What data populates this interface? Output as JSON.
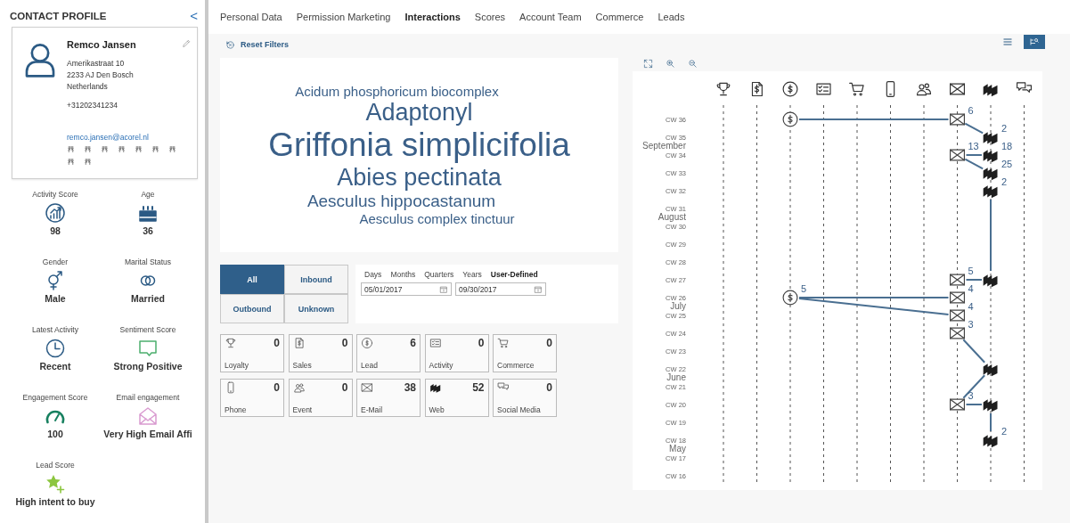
{
  "sidebar": {
    "title": "CONTACT PROFILE",
    "collapse": "<",
    "contact": {
      "name": "Remco Jansen",
      "address": [
        "Amerikastraat 10",
        "2233 AJ Den Bosch",
        "Netherlands"
      ],
      "phone": "+31202341234",
      "email": "remco.jansen@acorel.nl",
      "links": [
        {
          "kind": "link"
        },
        {
          "kind": "link"
        },
        {
          "kind": "link"
        },
        {
          "kind": "link"
        },
        {
          "kind": "link"
        },
        {
          "kind": "link"
        },
        {
          "kind": "link"
        },
        {
          "kind": "link"
        },
        {
          "kind": "link"
        }
      ]
    },
    "stats": [
      {
        "label": "Activity Score",
        "kind": "activity",
        "value": "98"
      },
      {
        "label": "Age",
        "kind": "age",
        "value": "36"
      },
      {
        "label": "Gender",
        "kind": "gender",
        "value": "Male"
      },
      {
        "label": "Marital Status",
        "kind": "marital",
        "value": "Married"
      },
      {
        "label": "Latest Activity",
        "kind": "latest",
        "value": "Recent"
      },
      {
        "label": "Sentiment Score",
        "kind": "sentiment",
        "value": "Strong Positive"
      },
      {
        "label": "Engagement Score",
        "kind": "engagement",
        "value": "100"
      },
      {
        "label": "Email engagement",
        "kind": "email",
        "value": "Very High Email Affi"
      },
      {
        "label": "Lead Score",
        "kind": "lead",
        "value": "High intent to buy"
      }
    ]
  },
  "tabs": [
    {
      "label": "Personal Data",
      "selected": false
    },
    {
      "label": "Permission Marketing",
      "selected": false
    },
    {
      "label": "Interactions",
      "selected": true
    },
    {
      "label": "Scores",
      "selected": false
    },
    {
      "label": "Account Team",
      "selected": false
    },
    {
      "label": "Commerce",
      "selected": false
    },
    {
      "label": "Leads",
      "selected": false
    }
  ],
  "reset_filters": "Reset Filters",
  "view_toggle": [
    {
      "kind": "list",
      "selected": false
    },
    {
      "kind": "timeline",
      "selected": true
    }
  ],
  "word_cloud": [
    {
      "text": "Acidum phosphoricum biocomplex",
      "kind": "small"
    },
    {
      "text": "Adaptonyl",
      "kind": "large"
    },
    {
      "text": "Griffonia simplicifolia",
      "kind": "huge"
    },
    {
      "text": "Abies pectinata",
      "kind": "large"
    },
    {
      "text": "Aesculus hippocastanum",
      "kind": "medium"
    },
    {
      "text": "Aesculus complex tinctuur",
      "kind": "small"
    }
  ],
  "direction": [
    {
      "label": "All",
      "selected": true
    },
    {
      "label": "Inbound",
      "selected": false
    },
    {
      "label": "Outbound",
      "selected": false
    },
    {
      "label": "Unknown",
      "selected": false
    }
  ],
  "periods": [
    {
      "label": "Days",
      "selected": false
    },
    {
      "label": "Months",
      "selected": false
    },
    {
      "label": "Quarters",
      "selected": false
    },
    {
      "label": "Years",
      "selected": false
    },
    {
      "label": "User-Defined",
      "selected": true
    }
  ],
  "date_from": "05/01/2017",
  "date_to": "09/30/2017",
  "tiles": [
    {
      "kind": "loyalty",
      "label": "Loyalty",
      "count": "0"
    },
    {
      "kind": "sales",
      "label": "Sales",
      "count": "0"
    },
    {
      "kind": "lead",
      "label": "Lead",
      "count": "6"
    },
    {
      "kind": "activity",
      "label": "Activity",
      "count": "0"
    },
    {
      "kind": "commerce",
      "label": "Commerce",
      "count": "0"
    },
    {
      "kind": "phone",
      "label": "Phone",
      "count": "0"
    },
    {
      "kind": "event",
      "label": "Event",
      "count": "0"
    },
    {
      "kind": "email",
      "label": "E-Mail",
      "count": "38"
    },
    {
      "kind": "web",
      "label": "Web",
      "count": "52"
    },
    {
      "kind": "social",
      "label": "Social Media",
      "count": "0"
    }
  ],
  "timeline": {
    "tools": [
      {
        "kind": "fit"
      },
      {
        "kind": "zoom_in"
      },
      {
        "kind": "zoom_out"
      }
    ],
    "channels": [
      {
        "kind": "loyalty"
      },
      {
        "kind": "sales"
      },
      {
        "kind": "lead"
      },
      {
        "kind": "activity"
      },
      {
        "kind": "commerce"
      },
      {
        "kind": "phone"
      },
      {
        "kind": "event"
      },
      {
        "kind": "email"
      },
      {
        "kind": "web"
      },
      {
        "kind": "social"
      }
    ],
    "weeks": [
      {
        "label": "CW 36",
        "events": [
          {
            "kind": "lead",
            "links": [
              {
                "kind": "email_same_week"
              }
            ]
          },
          {
            "kind": "email",
            "count": "6",
            "links": [
              {
                "kind": "web_next_week"
              }
            ]
          }
        ]
      },
      {
        "label": "CW 35",
        "events": [
          {
            "kind": "web",
            "count": "2"
          }
        ]
      },
      {
        "label": "CW 34",
        "month": "September",
        "events": [
          {
            "kind": "email",
            "count": "13",
            "links": [
              {
                "kind": "web_same_week"
              },
              {
                "kind": "web_next_week"
              }
            ]
          },
          {
            "kind": "web",
            "count": "18"
          }
        ]
      },
      {
        "label": "CW 33",
        "events": [
          {
            "kind": "web",
            "count": "25"
          }
        ]
      },
      {
        "label": "CW 32",
        "events": [
          {
            "kind": "web",
            "count": "2",
            "links": [
              {
                "kind": "web_five_weeks_on"
              }
            ]
          }
        ]
      },
      {
        "label": "CW 31"
      },
      {
        "label": "CW 30",
        "month": "August"
      },
      {
        "label": "CW 29"
      },
      {
        "label": "CW 28"
      },
      {
        "label": "CW 27",
        "events": [
          {
            "kind": "email",
            "count": "5",
            "links": [
              {
                "kind": "web_same_week"
              }
            ]
          },
          {
            "kind": "web"
          }
        ]
      },
      {
        "label": "CW 26",
        "events": [
          {
            "kind": "lead",
            "count": "5",
            "links": [
              {
                "kind": "email_same_week"
              },
              {
                "kind": "email_next_week"
              }
            ]
          },
          {
            "kind": "email",
            "count": "4"
          }
        ]
      },
      {
        "label": "CW 25",
        "month": "July",
        "events": [
          {
            "kind": "email",
            "count": "4"
          }
        ]
      },
      {
        "label": "CW 24",
        "events": [
          {
            "kind": "email",
            "count": "3",
            "links": [
              {
                "kind": "web_two_weeks_on"
              }
            ]
          }
        ]
      },
      {
        "label": "CW 23"
      },
      {
        "label": "CW 22",
        "events": [
          {
            "kind": "web",
            "links": [
              {
                "kind": "email_two_weeks_on"
              }
            ]
          }
        ]
      },
      {
        "label": "CW 21",
        "month": "June"
      },
      {
        "label": "CW 20",
        "events": [
          {
            "kind": "email",
            "count": "3",
            "links": [
              {
                "kind": "web_same_week"
              }
            ]
          },
          {
            "kind": "web",
            "links": [
              {
                "kind": "web_two_weeks_on"
              }
            ]
          }
        ]
      },
      {
        "label": "CW 19"
      },
      {
        "label": "CW 18",
        "events": [
          {
            "kind": "web",
            "count": "2"
          }
        ]
      },
      {
        "label": "CW 17",
        "month": "May"
      },
      {
        "label": "CW 16"
      }
    ]
  }
}
